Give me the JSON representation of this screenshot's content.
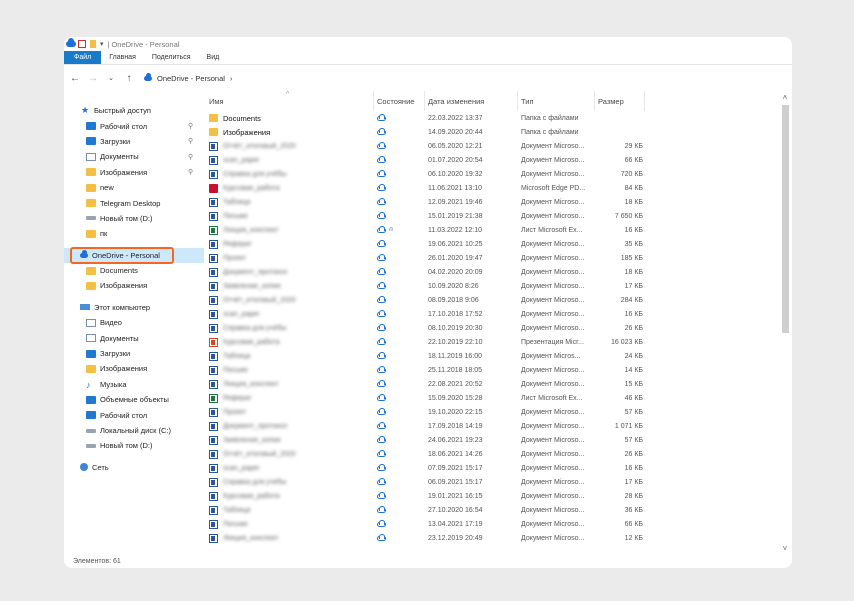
{
  "titlebar": {
    "title": "OneDrive - Personal",
    "separator": "|",
    "menu_caret": "▾"
  },
  "ribbon": {
    "tabs": [
      "Файл",
      "Главная",
      "Поделиться",
      "Вид"
    ]
  },
  "address": {
    "back": "←",
    "forward": "→",
    "history": "⌄",
    "up": "↑",
    "crumb": "OneDrive - Personal",
    "crumb_arrow": "›"
  },
  "sidebar": {
    "quick_access": "Быстрый доступ",
    "quick_items": [
      {
        "label": "Рабочий стол",
        "icon": "desktop-icon",
        "pinned": true
      },
      {
        "label": "Загрузки",
        "icon": "download-icon",
        "pinned": true
      },
      {
        "label": "Документы",
        "icon": "documents-icon",
        "pinned": true
      },
      {
        "label": "Изображения",
        "icon": "pictures-icon",
        "pinned": true
      },
      {
        "label": "new",
        "icon": "folder-icon",
        "pinned": false
      },
      {
        "label": "Telegram Desktop",
        "icon": "folder-icon",
        "pinned": false
      },
      {
        "label": "Новый том (D:)",
        "icon": "drive-icon",
        "pinned": false
      },
      {
        "label": "пк",
        "icon": "folder-icon",
        "pinned": false
      }
    ],
    "onedrive": "OneDrive - Personal",
    "onedrive_items": [
      "Documents",
      "Изображения"
    ],
    "this_pc": "Этот компьютер",
    "pc_items": [
      {
        "label": "Видео",
        "icon": "video-icon"
      },
      {
        "label": "Документы",
        "icon": "documents-icon"
      },
      {
        "label": "Загрузки",
        "icon": "download-icon"
      },
      {
        "label": "Изображения",
        "icon": "pictures-icon"
      },
      {
        "label": "Музыка",
        "icon": "music-icon"
      },
      {
        "label": "Объемные объекты",
        "icon": "3d-objects-icon"
      },
      {
        "label": "Рабочий стол",
        "icon": "desktop-icon"
      },
      {
        "label": "Локальный диск (C:)",
        "icon": "drive-icon"
      },
      {
        "label": "Новый том (D:)",
        "icon": "drive-icon"
      }
    ],
    "network": "Сеть",
    "pin_glyph": "📌"
  },
  "columns": {
    "name": "Имя",
    "state": "Состояние",
    "date": "Дата изменения",
    "type": "Тип",
    "size": "Размер",
    "sort_glyph": "^"
  },
  "files": [
    {
      "name": "Documents",
      "kind": "folder",
      "blur": false,
      "state": "cloud",
      "date": "22.03.2022 13:37",
      "type": "Папка с файлами",
      "size": ""
    },
    {
      "name": "Изображения",
      "kind": "folder",
      "blur": false,
      "state": "cloud",
      "date": "14.09.2020 20:44",
      "type": "Папка с файлами",
      "size": ""
    },
    {
      "name": "",
      "kind": "word",
      "blur": true,
      "state": "cloud",
      "date": "06.05.2020 12:21",
      "type": "Документ Microso...",
      "size": "29 КБ"
    },
    {
      "name": "",
      "kind": "word",
      "blur": true,
      "state": "cloud",
      "date": "01.07.2020 20:54",
      "type": "Документ Microso...",
      "size": "66 КБ"
    },
    {
      "name": "",
      "kind": "word",
      "blur": true,
      "state": "cloud",
      "date": "06.10.2020 19:32",
      "type": "Документ Microso...",
      "size": "720 КБ"
    },
    {
      "name": "",
      "kind": "pdf",
      "blur": true,
      "state": "cloud",
      "date": "11.06.2021 13:10",
      "type": "Microsoft Edge PD...",
      "size": "84 КБ"
    },
    {
      "name": "",
      "kind": "word",
      "blur": true,
      "state": "cloud",
      "date": "12.09.2021 19:46",
      "type": "Документ Microso...",
      "size": "18 КБ"
    },
    {
      "name": "",
      "kind": "word",
      "blur": true,
      "state": "cloud",
      "date": "15.01.2019 21:38",
      "type": "Документ Microso...",
      "size": "7 650 КБ"
    },
    {
      "name": "",
      "kind": "excel",
      "blur": true,
      "state": "cloud-shared",
      "date": "11.03.2022 12:10",
      "type": "Лист Microsoft Ex...",
      "size": "16 КБ"
    },
    {
      "name": "",
      "kind": "word",
      "blur": true,
      "state": "cloud",
      "date": "19.06.2021 10:25",
      "type": "Документ Microso...",
      "size": "35 КБ"
    },
    {
      "name": "",
      "kind": "word",
      "blur": true,
      "state": "cloud",
      "date": "26.01.2020 19:47",
      "type": "Документ Microso...",
      "size": "185 КБ"
    },
    {
      "name": "",
      "kind": "word",
      "blur": true,
      "state": "cloud",
      "date": "04.02.2020 20:09",
      "type": "Документ Microso...",
      "size": "18 КБ"
    },
    {
      "name": "",
      "kind": "word",
      "blur": true,
      "state": "cloud",
      "date": "10.09.2020 8:26",
      "type": "Документ Microso...",
      "size": "17 КБ"
    },
    {
      "name": "",
      "kind": "word",
      "blur": true,
      "state": "cloud",
      "date": "08.09.2018 9:06",
      "type": "Документ Microso...",
      "size": "284 КБ"
    },
    {
      "name": "",
      "kind": "word",
      "blur": true,
      "state": "cloud",
      "date": "17.10.2018 17:52",
      "type": "Документ Microso...",
      "size": "16 КБ"
    },
    {
      "name": "",
      "kind": "word",
      "blur": true,
      "state": "cloud",
      "date": "08.10.2019 20:30",
      "type": "Документ Microso...",
      "size": "26 КБ"
    },
    {
      "name": "",
      "kind": "ppt",
      "blur": true,
      "state": "cloud",
      "date": "22.10.2019 22:10",
      "type": "Презентация Micr...",
      "size": "16 023 КБ"
    },
    {
      "name": "",
      "kind": "word",
      "blur": true,
      "state": "cloud",
      "date": "18.11.2019 16:00",
      "type": "Документ Micros...",
      "size": "24 КБ"
    },
    {
      "name": "",
      "kind": "word",
      "blur": true,
      "state": "cloud",
      "date": "25.11.2018 18:05",
      "type": "Документ Microso...",
      "size": "14 КБ"
    },
    {
      "name": "",
      "kind": "word",
      "blur": true,
      "state": "cloud",
      "date": "22.08.2021 20:52",
      "type": "Документ Microso...",
      "size": "15 КБ"
    },
    {
      "name": "",
      "kind": "excel",
      "blur": true,
      "state": "cloud",
      "date": "15.09.2020 15:28",
      "type": "Лист Microsoft Ex...",
      "size": "46 КБ"
    },
    {
      "name": "",
      "kind": "word",
      "blur": true,
      "state": "cloud",
      "date": "19.10.2020 22:15",
      "type": "Документ Microso...",
      "size": "57 КБ"
    },
    {
      "name": "",
      "kind": "word",
      "blur": true,
      "state": "cloud",
      "date": "17.09.2018 14:19",
      "type": "Документ Microso...",
      "size": "1 071 КБ"
    },
    {
      "name": "",
      "kind": "word",
      "blur": true,
      "state": "cloud",
      "date": "24.06.2021 19:23",
      "type": "Документ Microso...",
      "size": "57 КБ"
    },
    {
      "name": "",
      "kind": "word",
      "blur": true,
      "state": "cloud",
      "date": "18.06.2021 14:26",
      "type": "Документ Microso...",
      "size": "26 КБ"
    },
    {
      "name": "",
      "kind": "word",
      "blur": true,
      "state": "cloud",
      "date": "07.09.2021 15:17",
      "type": "Документ Microso...",
      "size": "16 КБ"
    },
    {
      "name": "",
      "kind": "word",
      "blur": true,
      "state": "cloud",
      "date": "06.09.2021 15:17",
      "type": "Документ Microso...",
      "size": "17 КБ"
    },
    {
      "name": "",
      "kind": "word",
      "blur": true,
      "state": "cloud",
      "date": "19.01.2021 16:15",
      "type": "Документ Microso...",
      "size": "28 КБ"
    },
    {
      "name": "",
      "kind": "word",
      "blur": true,
      "state": "cloud",
      "date": "27.10.2020 16:54",
      "type": "Документ Microso...",
      "size": "36 КБ"
    },
    {
      "name": "",
      "kind": "word",
      "blur": true,
      "state": "cloud",
      "date": "13.04.2021 17:19",
      "type": "Документ Microso...",
      "size": "66 КБ"
    },
    {
      "name": "",
      "kind": "word",
      "blur": true,
      "state": "cloud",
      "date": "23.12.2019 20:49",
      "type": "Документ Microso...",
      "size": "12 КБ"
    }
  ],
  "status": {
    "items_label": "Элементов: 61"
  },
  "scroll": {
    "up": "˄",
    "down": "˅"
  },
  "colors": {
    "accent": "#1979ca",
    "highlight_border": "#f26822",
    "onedrive_blue": "#1e6fd8"
  }
}
